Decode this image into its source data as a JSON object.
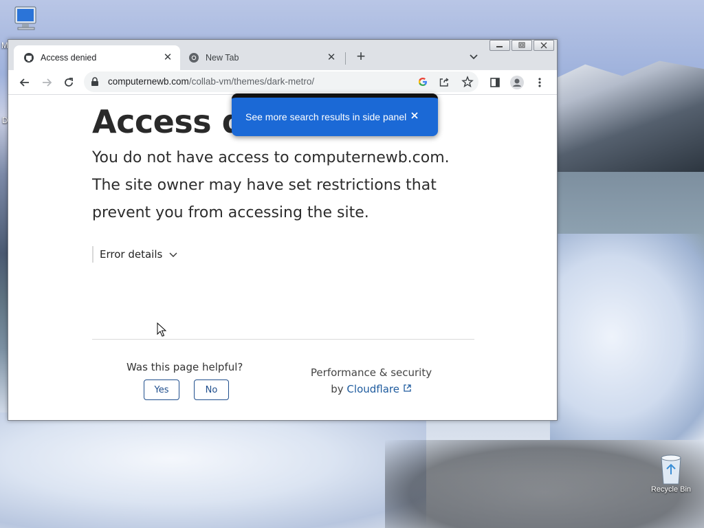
{
  "desktop": {
    "top_left_label": "M",
    "left_edge_label": "D",
    "recycle_bin_label": "Recycle Bin"
  },
  "window_controls": {
    "minimize": "minimize",
    "maximize": "maximize",
    "close": "close"
  },
  "tabs": [
    {
      "title": "Access denied",
      "active": true
    },
    {
      "title": "New Tab",
      "active": false
    }
  ],
  "toolbar": {
    "url_host": "computernewb.com",
    "url_path": "/collab-vm/themes/dark-metro/"
  },
  "popup": {
    "message": "See more search results in side panel"
  },
  "page": {
    "heading": "Access denied",
    "line1": "You do not have access to computernewb.com.",
    "line2": "The site owner may have set restrictions that prevent you from accessing the site.",
    "error_details": "Error details",
    "helpful_question": "Was this page helpful?",
    "yes": "Yes",
    "no": "No",
    "perf_line1": "Performance & security",
    "perf_by": "by",
    "perf_link": "Cloudflare"
  },
  "colors": {
    "accent_blue": "#1b69d6",
    "button_border": "#1e4d8c",
    "tabstrip_bg": "#dee1e6"
  }
}
